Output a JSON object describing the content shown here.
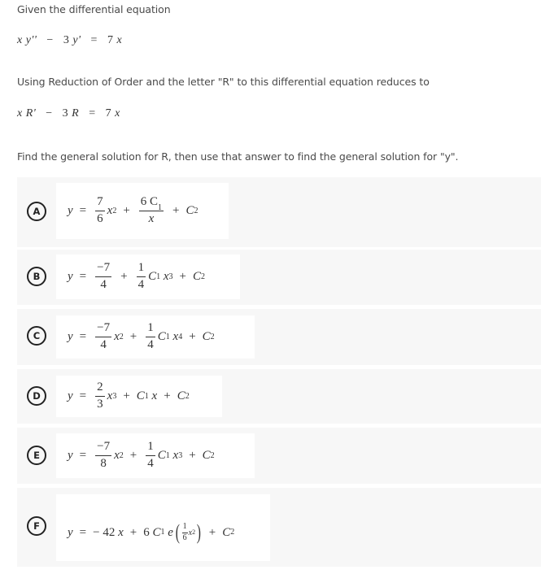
{
  "intro": "Given the differential equation",
  "equation": {
    "lhs_a": "x",
    "lhs_b": "y''",
    "minus": "−",
    "coef": "3",
    "lhs_c": "y'",
    "eq": "=",
    "rhs_coef": "7",
    "rhs_var": "x"
  },
  "reduction_text": "Using Reduction of Order and the letter \"R\" to this differential equation reduces to",
  "reduced": {
    "a": "x",
    "b": "R'",
    "minus": "−",
    "coef": "3",
    "c": "R",
    "eq": "=",
    "rhs_coef": "7",
    "rhs_var": "x"
  },
  "instruction": "Find the general solution for R, then use that answer to find the general solution for \"y\".",
  "options": [
    {
      "letter": "A",
      "y": "y",
      "eq": "=",
      "f1_num": "7",
      "f1_den": "6",
      "x": "x",
      "p1": "2",
      "plus": "+",
      "f2_num": "6 C",
      "f2_num_sub": "1",
      "f2_den": "x",
      "c": "C",
      "c_sub": "2"
    },
    {
      "letter": "B",
      "y": "y",
      "eq": "=",
      "f1_num": "−7",
      "f1_den": "4",
      "plus": "+",
      "f2_num": "1",
      "f2_den": "4",
      "c1": "C",
      "c1_sub": "1",
      "x": "x",
      "p2": "3",
      "c": "C",
      "c_sub": "2"
    },
    {
      "letter": "C",
      "y": "y",
      "eq": "=",
      "f1_num": "−7",
      "f1_den": "4",
      "x": "x",
      "p1": "2",
      "plus": "+",
      "f2_num": "1",
      "f2_den": "4",
      "c1": "C",
      "c1_sub": "1",
      "p2": "4",
      "c": "C",
      "c_sub": "2"
    },
    {
      "letter": "D",
      "y": "y",
      "eq": "=",
      "f1_num": "2",
      "f1_den": "3",
      "x": "x",
      "p1": "3",
      "plus": "+",
      "c1": "C",
      "c1_sub": "1",
      "c": "C",
      "c_sub": "2"
    },
    {
      "letter": "E",
      "y": "y",
      "eq": "=",
      "f1_num": "−7",
      "f1_den": "8",
      "x": "x",
      "p1": "2",
      "plus": "+",
      "f2_num": "1",
      "f2_den": "4",
      "c1": "C",
      "c1_sub": "1",
      "p2": "3",
      "c": "C",
      "c_sub": "2"
    },
    {
      "letter": "F",
      "y": "y",
      "eq": "=",
      "t1": "− 42",
      "x": "x",
      "plus": "+",
      "coef": "6",
      "c1": "C",
      "c1_sub": "1",
      "e": "e",
      "exp_num": "1",
      "exp_den": "6",
      "exp_p": "2",
      "c": "C",
      "c_sub": "2"
    }
  ]
}
